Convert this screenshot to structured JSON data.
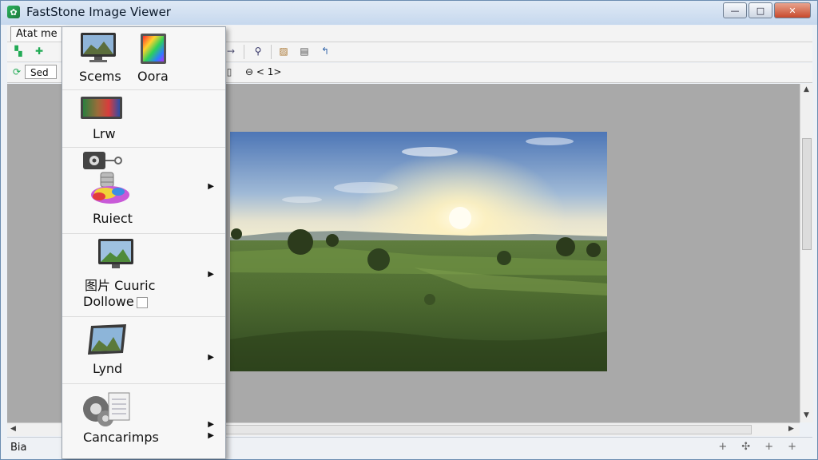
{
  "window": {
    "title": "FastStone Image Viewer"
  },
  "window_controls": {
    "minimize": "—",
    "maximize": "□",
    "close": "✕"
  },
  "menubar": {
    "item": "Atat me"
  },
  "toolbar2": {
    "sed_button": "Sed",
    "zoom_text": "⊖ < 1>"
  },
  "dropdown": {
    "items": [
      {
        "label": "Scems",
        "icon": "monitor-landscape-icon",
        "has_submenu": false
      },
      {
        "label": "Oora",
        "icon": "color-spectrum-icon",
        "has_submenu": false
      },
      {
        "label": "Lrw",
        "icon": "color-gradient-icon",
        "has_submenu": false
      },
      {
        "label": "Ruiect",
        "icon": "settings-palette-icon",
        "has_submenu": true
      },
      {
        "label": "图片 Cuuric",
        "label2": "Dollowe",
        "icon": "image-monitor-icon",
        "has_submenu": true
      },
      {
        "label": "Lynd",
        "icon": "landscape-frame-icon",
        "has_submenu": true
      },
      {
        "label": "Cancarimps",
        "icon": "gears-document-icon",
        "has_submenu": true
      }
    ],
    "submenu_arrow": "▶"
  },
  "statusbar": {
    "text": "Bia"
  },
  "status_icons": [
    "+",
    "✣",
    "+",
    "+"
  ],
  "colors": {
    "accent": "#4b73a4",
    "canvas": "#a9a9a9"
  }
}
